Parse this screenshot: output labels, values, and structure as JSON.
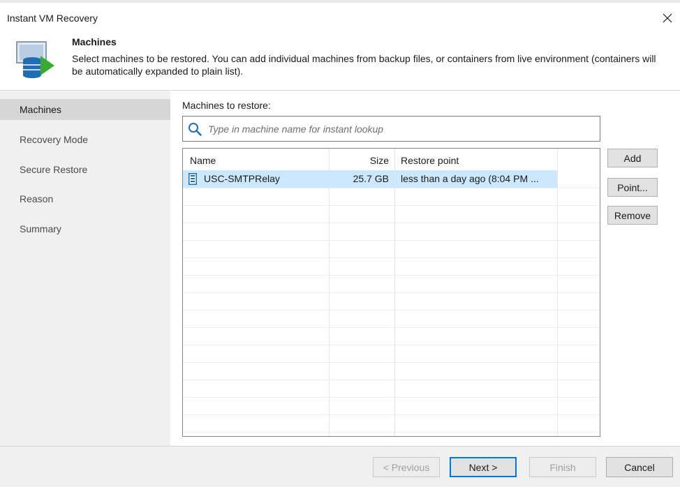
{
  "window": {
    "title": "Instant VM Recovery",
    "close_glyph": "✕"
  },
  "header": {
    "icon": "vm-database-restore-icon",
    "title": "Machines",
    "description": "Select machines to be restored. You can add individual machines from backup files, or containers from live environment (containers will be automatically expanded to plain list)."
  },
  "sidebar": {
    "items": [
      {
        "label": "Machines",
        "active": true
      },
      {
        "label": "Recovery Mode",
        "active": false
      },
      {
        "label": "Secure Restore",
        "active": false
      },
      {
        "label": "Reason",
        "active": false
      },
      {
        "label": "Summary",
        "active": false
      }
    ]
  },
  "main": {
    "machines_label": "Machines to restore:",
    "search": {
      "placeholder": "Type in machine name for instant lookup",
      "value": "",
      "icon": "search-icon"
    },
    "table": {
      "columns": [
        "Name",
        "Size",
        "Restore point"
      ],
      "rows": [
        {
          "name": "USC-SMTPRelay",
          "size": "25.7 GB",
          "restore_point": "less than a day ago (8:04 PM ...",
          "icon": "vm-icon",
          "selected": true
        }
      ]
    },
    "buttons": {
      "add": "Add",
      "point": "Point...",
      "remove": "Remove"
    }
  },
  "footer": {
    "previous": "< Previous",
    "next": "Next >",
    "finish": "Finish",
    "cancel": "Cancel"
  },
  "colors": {
    "accent": "#0078d7",
    "selection": "#cce8ff",
    "sidebar_bg": "#f0f0f0",
    "sidebar_active": "#d6d6d6",
    "icon_green": "#3aaa35",
    "icon_blue": "#1f6db5"
  }
}
